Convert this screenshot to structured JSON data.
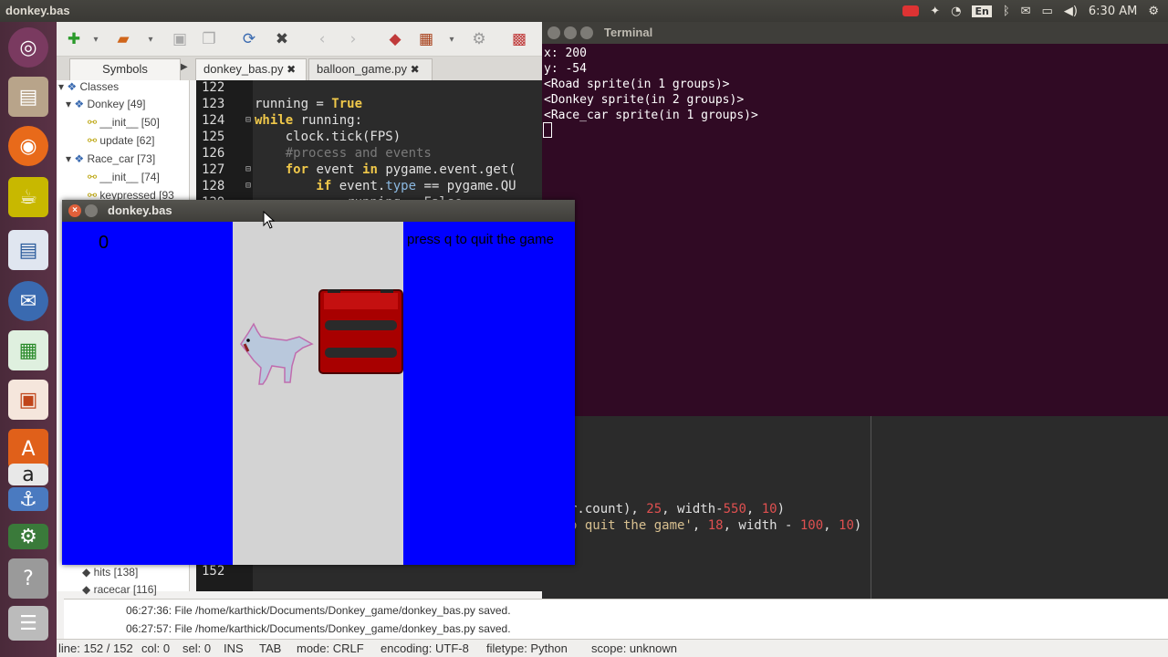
{
  "topbar": {
    "title": "donkey.bas",
    "lang": "En",
    "time": "6:30 AM"
  },
  "geany": {
    "sidebar_tab": "Symbols",
    "tabs": [
      "donkey_bas.py",
      "balloon_game.py"
    ],
    "symbols": [
      {
        "label": "Classes"
      },
      {
        "label": "Donkey [49]"
      },
      {
        "label": "__init__ [50]"
      },
      {
        "label": "update [62]"
      },
      {
        "label": "Race_car [73]"
      },
      {
        "label": "__init__ [74]"
      },
      {
        "label": "keypressed [93"
      },
      {
        "label": "hits [138]"
      },
      {
        "label": "racecar [116]"
      }
    ],
    "line_numbers": [
      "122",
      "123",
      "124",
      "125",
      "126",
      "127",
      "128",
      "129",
      "152"
    ],
    "code": {
      "l123a": "running = ",
      "l123b": "True",
      "l124a": "while",
      "l124b": " running:",
      "l125": "    clock.tick(FPS)",
      "l126": "    #process and events",
      "l127a": "    for",
      "l127b": " event ",
      "l127c": "in",
      "l127d": " pygame.event.get(",
      "l128a": "        if",
      "l128b": " event.",
      "l128c": "type",
      "l128d": " == pygame.QU",
      "l129": "            running = False"
    }
  },
  "terminal": {
    "title": "Terminal",
    "lines": [
      "x: 200",
      "y: -54",
      "<Road sprite(in 1 groups)>",
      "<Donkey sprite(in 2 groups)>",
      "<Race_car sprite(in 1 groups)>"
    ]
  },
  "bgcode": {
    "l1a": "r.count), ",
    "l1b": "25",
    "l1c": ", width-",
    "l1d": "550",
    "l1e": ", ",
    "l1f": "10",
    "l1g": ")",
    "l2a": "o quit the game'",
    "l2b": ", ",
    "l2c": "18",
    "l2d": ", width - ",
    "l2e": "100",
    "l2f": ", ",
    "l2g": "10",
    "l2h": ")"
  },
  "messages": [
    "06:27:36: File /home/karthick/Documents/Donkey_game/donkey_bas.py saved.",
    "06:27:57: File /home/karthick/Documents/Donkey_game/donkey_bas.py saved."
  ],
  "statusbar": {
    "line": "line: 152 / 152",
    "col": "col: 0",
    "sel": "sel: 0",
    "ins": "INS",
    "tab": "TAB",
    "mode": "mode: CRLF",
    "encoding": "encoding: UTF-8",
    "filetype": "filetype: Python",
    "scope": "scope: unknown"
  },
  "game": {
    "window_title": "donkey.bas",
    "score": "0",
    "quit_text": "press q to quit the game"
  },
  "colors": {
    "sky": "#0000ff",
    "road": "#d3d3d3",
    "car": "#a80000",
    "terminal_bg": "#300a24"
  }
}
